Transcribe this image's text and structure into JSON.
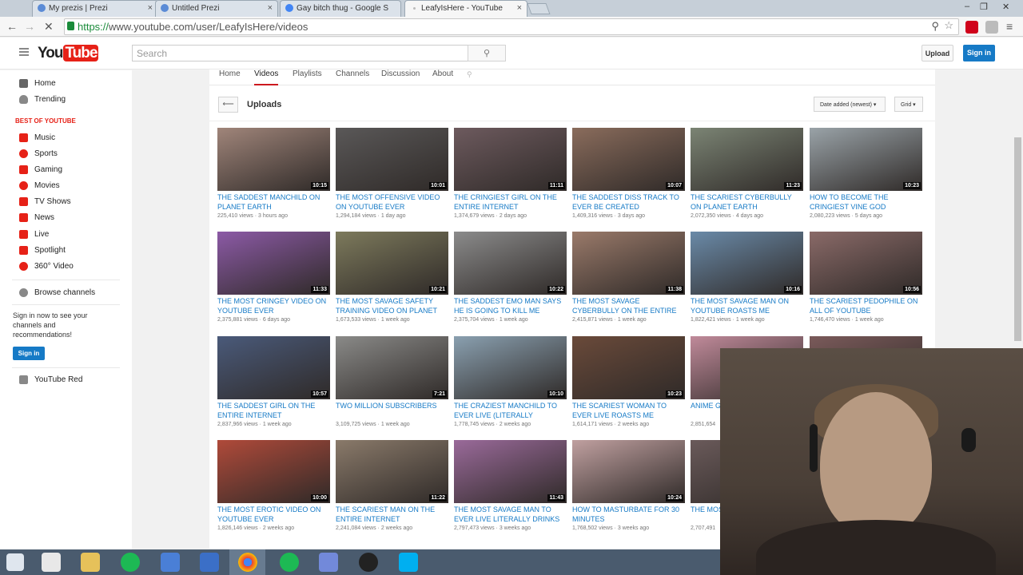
{
  "browser": {
    "tabs": [
      {
        "label": "My prezis | Prezi",
        "active": false
      },
      {
        "label": "Untitled Prezi",
        "active": false
      },
      {
        "label": "Gay bitch thug - Google S",
        "active": false
      },
      {
        "label": "LeafyIsHere - YouTube",
        "active": true
      }
    ],
    "url_scheme": "https://",
    "url_rest": "www.youtube.com/user/LeafyIsHere/videos",
    "icons": [
      "back-icon",
      "forward-icon",
      "stop-loading-icon",
      "zoom-icon",
      "star-icon",
      "adblock-icon",
      "extension-icon",
      "menu-icon"
    ]
  },
  "masthead": {
    "logo_you": "You",
    "logo_tube": "Tube",
    "search_placeholder": "Search",
    "upload_label": "Upload",
    "signin_label": "Sign in"
  },
  "guide": {
    "top_items": [
      "Home",
      "Trending"
    ],
    "section_title": "BEST OF YOUTUBE",
    "best_items": [
      "Music",
      "Sports",
      "Gaming",
      "Movies",
      "TV Shows",
      "News",
      "Live",
      "Spotlight",
      "360° Video"
    ],
    "browse_channels": "Browse channels",
    "signin_text": "Sign in now to see your channels and recommendations!",
    "signin_button": "Sign in",
    "youtube_red": "YouTube Red",
    "accent_color": "#e62117"
  },
  "channel": {
    "tabs": [
      "Home",
      "Videos",
      "Playlists",
      "Channels",
      "Discussion",
      "About"
    ],
    "active_tab": "Videos",
    "uploads_title": "Uploads",
    "sort_label": "Date added (newest) ▾",
    "view_label": "Grid ▾"
  },
  "videos": [
    {
      "title": "THE SADDEST MANCHILD ON PLANET EARTH",
      "views": "225,410 views",
      "age": "3 hours ago",
      "duration": "10:15",
      "color": "#a0857a"
    },
    {
      "title": "THE MOST OFFENSIVE VIDEO ON YOUTUBE EVER",
      "views": "1,294,184 views",
      "age": "1 day ago",
      "duration": "10:01",
      "color": "#5a5858"
    },
    {
      "title": "THE CRINGIEST GIRL ON THE ENTIRE INTERNET",
      "views": "1,374,679 views",
      "age": "2 days ago",
      "duration": "11:11",
      "color": "#6d5a5e"
    },
    {
      "title": "THE SADDEST DISS TRACK TO EVER BE CREATED",
      "views": "1,409,316 views",
      "age": "3 days ago",
      "duration": "10:07",
      "color": "#8a6c5c"
    },
    {
      "title": "THE SCARIEST CYBERBULLY ON PLANET EARTH",
      "views": "2,072,350 views",
      "age": "4 days ago",
      "duration": "11:23",
      "color": "#7b8474"
    },
    {
      "title": "HOW TO BECOME THE CRINGIEST VINE GOD",
      "views": "2,080,223 views",
      "age": "5 days ago",
      "duration": "10:23",
      "color": "#9aa3a8"
    },
    {
      "title": "THE MOST CRINGEY VIDEO ON YOUTUBE EVER",
      "views": "2,375,881 views",
      "age": "6 days ago",
      "duration": "11:33",
      "color": "#8c5aa6"
    },
    {
      "title": "THE MOST SAVAGE SAFETY TRAINING VIDEO ON PLANET",
      "views": "1,673,533 views",
      "age": "1 week ago",
      "duration": "10:21",
      "color": "#7d7a5c"
    },
    {
      "title": "THE SADDEST EMO MAN SAYS HE IS GOING TO KILL ME",
      "views": "2,375,704 views",
      "age": "1 week ago",
      "duration": "10:22",
      "color": "#8b8b8b"
    },
    {
      "title": "THE MOST SAVAGE CYBERBULLY ON THE ENTIRE INTERNET",
      "views": "2,415,871 views",
      "age": "1 week ago",
      "duration": "11:38",
      "color": "#9a7a6a"
    },
    {
      "title": "THE MOST SAVAGE MAN ON YOUTUBE ROASTS ME",
      "views": "1,822,421 views",
      "age": "1 week ago",
      "duration": "10:16",
      "color": "#6a8aa8"
    },
    {
      "title": "THE SCARIEST PEDOPHILE ON ALL OF YOUTUBE",
      "views": "1,746,470 views",
      "age": "1 week ago",
      "duration": "10:56",
      "color": "#8a6a68"
    },
    {
      "title": "THE SADDEST GIRL ON THE ENTIRE INTERNET",
      "views": "2,837,966 views",
      "age": "1 week ago",
      "duration": "10:57",
      "color": "#4a5a7a"
    },
    {
      "title": "TWO MILLION SUBSCRIBERS",
      "views": "3,109,725 views",
      "age": "1 week ago",
      "duration": "7:21",
      "color": "#8a8a88"
    },
    {
      "title": "THE CRAZIEST MANCHILD TO EVER LIVE (LITERALLY BREAKS...",
      "views": "1,778,745 views",
      "age": "2 weeks ago",
      "duration": "10:10",
      "color": "#8aa0b0"
    },
    {
      "title": "THE SCARIEST WOMAN TO EVER LIVE ROASTS ME",
      "views": "1,614,171 views",
      "age": "2 weeks ago",
      "duration": "10:23",
      "color": "#6a4a3a"
    },
    {
      "title": "ANIME G... PILLOW",
      "views": "2,851,654",
      "age": "",
      "duration": "",
      "color": "#c08a9a"
    },
    {
      "title": "",
      "views": "",
      "age": "",
      "duration": "",
      "color": "#7a5a5a"
    },
    {
      "title": "THE MOST EROTIC VIDEO ON YOUTUBE EVER",
      "views": "1,826,146 views",
      "age": "2 weeks ago",
      "duration": "10:00",
      "color": "#b04a3a"
    },
    {
      "title": "THE SCARIEST MAN ON THE ENTIRE INTERNET",
      "views": "2,241,084 views",
      "age": "2 weeks ago",
      "duration": "11:22",
      "color": "#8a7a6a"
    },
    {
      "title": "THE MOST SAVAGE MAN TO EVER LIVE LITERALLY DRINKS",
      "views": "2,797,473 views",
      "age": "3 weeks ago",
      "duration": "11:43",
      "color": "#9a6a9a"
    },
    {
      "title": "HOW TO MASTURBATE FOR 30 MINUTES",
      "views": "1,768,502 views",
      "age": "3 weeks ago",
      "duration": "10:24",
      "color": "#c0a0a0"
    },
    {
      "title": "THE MOS... INTERNE...",
      "views": "2,707,491",
      "age": "",
      "duration": "",
      "color": "#6a5a5a"
    }
  ],
  "taskbar": {
    "icons": [
      "windows-start-icon",
      "home-icon",
      "file-explorer-icon",
      "spotify-icon",
      "app-icon",
      "settings-app-icon",
      "chrome-icon",
      "spotify-icon",
      "discord-icon",
      "obs-icon",
      "skype-icon"
    ],
    "active": "chrome-icon"
  }
}
